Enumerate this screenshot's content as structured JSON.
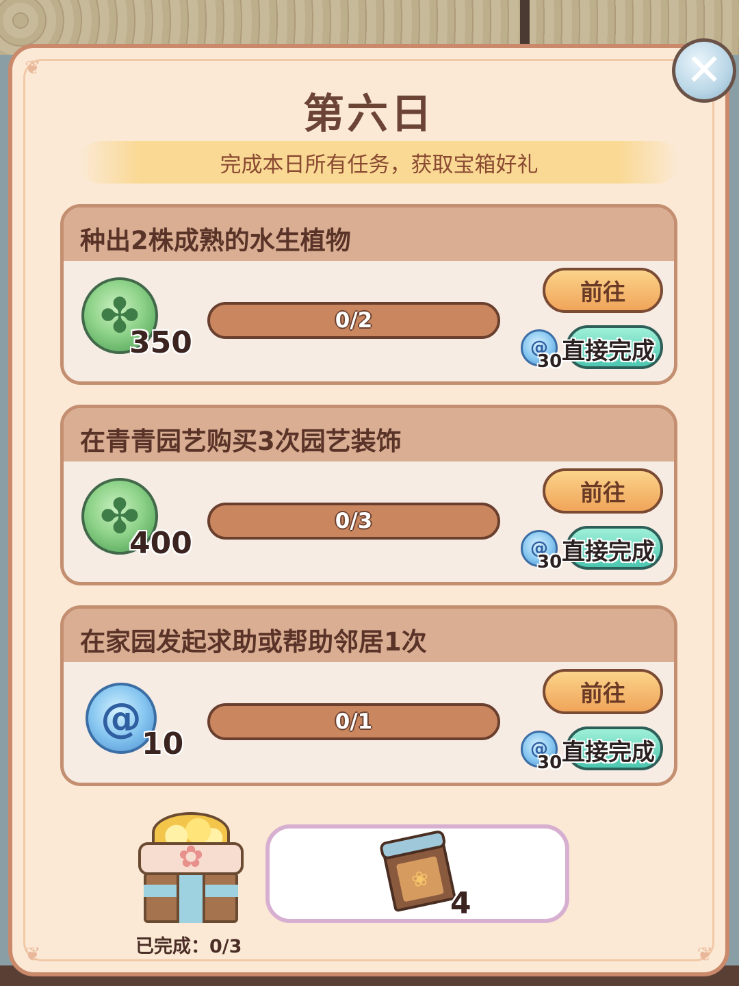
{
  "dialog": {
    "title": "第六日",
    "subtitle": "完成本日所有任务，获取宝箱好礼",
    "close_icon": "close-x-icon"
  },
  "tasks": [
    {
      "title": "种出2株成熟的水生植物",
      "reward_icon": "leaf-coin-icon",
      "reward_amount": "350",
      "progress": "0/2",
      "progress_fraction": 0,
      "go_label": "前往",
      "complete_label": "直接完成",
      "complete_cost_icon": "swirl-gem-icon",
      "complete_cost": "30"
    },
    {
      "title": "在青青园艺购买3次园艺装饰",
      "reward_icon": "leaf-coin-icon",
      "reward_amount": "400",
      "progress": "0/3",
      "progress_fraction": 0,
      "go_label": "前往",
      "complete_label": "直接完成",
      "complete_cost_icon": "swirl-gem-icon",
      "complete_cost": "30"
    },
    {
      "title": "在家园发起求助或帮助邻居1次",
      "reward_icon": "swirl-gem-icon",
      "reward_amount": "10",
      "progress": "0/1",
      "progress_fraction": 0,
      "go_label": "前往",
      "complete_label": "直接完成",
      "complete_cost_icon": "swirl-gem-icon",
      "complete_cost": "30"
    }
  ],
  "chest": {
    "icon": "gift-chest-icon",
    "completed_label": "已完成：0/3"
  },
  "chest_reward": {
    "icon": "scroll-item-icon",
    "count": "4"
  },
  "colors": {
    "panel_bg": "#fbe9d5",
    "panel_border": "#c9896a",
    "go_button": "#f0a55a",
    "complete_button": "#4cc6b0",
    "progress_bar": "#c9865f"
  }
}
